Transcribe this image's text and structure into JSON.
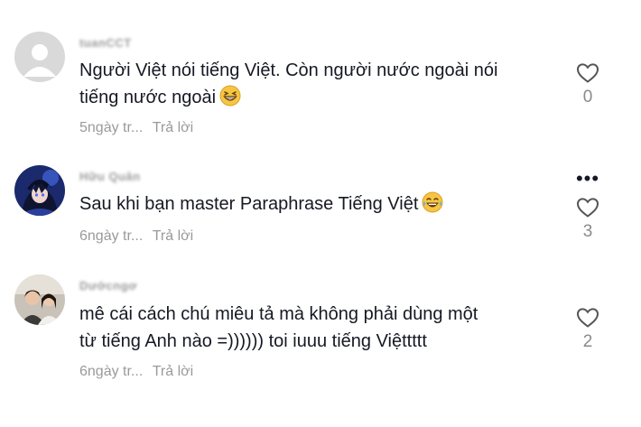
{
  "comments": [
    {
      "username": "tuanCCT",
      "text_line1": "Người Việt nói tiếng Việt. Còn người nước ngoài nói",
      "text_line2": "tiếng nước ngoài",
      "emoji": "grinning-squint-face",
      "time": "5ngày tr...",
      "reply_label": "Trả lời",
      "likes": "0"
    },
    {
      "username": "Hữu Quân",
      "text_line1": "Sau khi bạn master Paraphrase Tiếng Việt",
      "emoji": "tears-of-joy-face",
      "time": "6ngày tr...",
      "reply_label": "Trả lời",
      "likes": "3",
      "more_icon": "•••"
    },
    {
      "username": "Dướcngơ",
      "text_line1": "mê cái cách chú miêu tả mà không phải dùng một",
      "text_line2": "từ tiếng Anh nào =)))))) toi iuuu tiếng Việttttt",
      "time": "6ngày tr...",
      "reply_label": "Trả lời",
      "likes": "2"
    }
  ],
  "colors": {
    "text": "#161823",
    "muted": "#9a9a9a",
    "avatar_placeholder": "#d9d9d9"
  }
}
